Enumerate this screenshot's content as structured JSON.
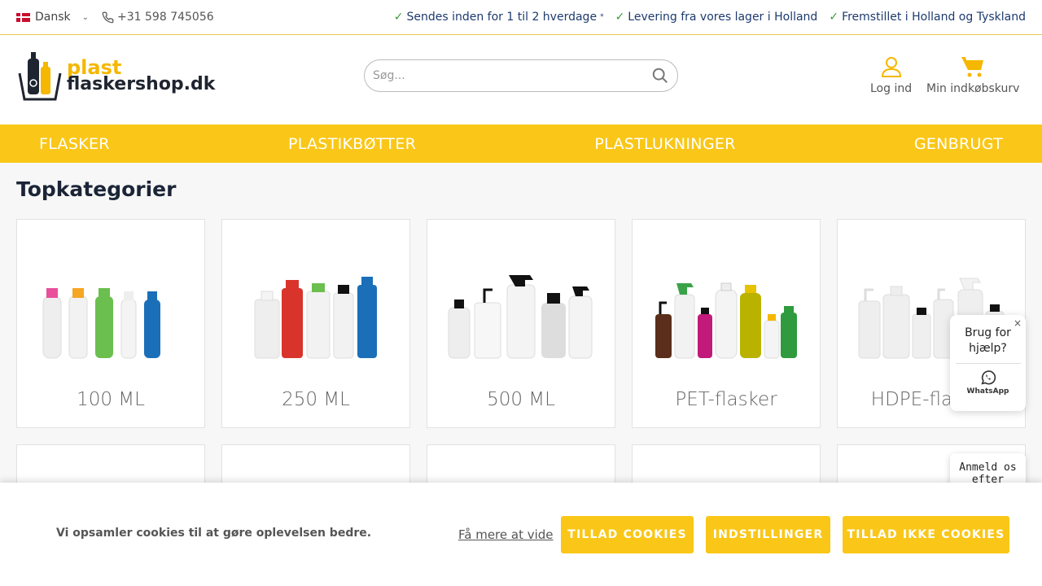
{
  "topbar": {
    "language": "Dansk",
    "phone": "+31 598 745056",
    "usps": [
      {
        "text": "Sendes inden for 1 til 2 hverdage",
        "mark": "*"
      },
      {
        "text": "Levering fra vores lager i Holland",
        "mark": ""
      },
      {
        "text": "Fremstillet i Holland og Tyskland",
        "mark": ""
      }
    ]
  },
  "header": {
    "logo_line1": "plast",
    "logo_line2": "flaskershop.dk",
    "search_placeholder": "Søg...",
    "login_label": "Log ind",
    "cart_label": "Min indkøbskurv"
  },
  "nav": {
    "items": [
      "FLASKER",
      "PLASTIKBØTTER",
      "PLASTLUKNINGER",
      "GENBRUGT"
    ]
  },
  "main": {
    "title": "Topkategorier",
    "categories": [
      {
        "label": "100 ML"
      },
      {
        "label": "250 ML"
      },
      {
        "label": "500 ML"
      },
      {
        "label": "PET-flasker"
      },
      {
        "label": "HDPE-flasker"
      }
    ]
  },
  "help_widget": {
    "text": "Brug for hjælp?",
    "close": "×",
    "whatsapp_label": "WhatsApp"
  },
  "review_widget": {
    "text": "Anmeld os efter"
  },
  "cookie": {
    "message": "Vi opsamler cookies til at gøre oplevelsen bedre.",
    "learn_more": "Få mere at vide",
    "allow": "TILLAD COOKIES",
    "settings": "INDSTILLINGER",
    "deny": "TILLAD IKKE COOKIES"
  },
  "colors": {
    "accent": "#fac718",
    "nav_text": "#ffffff",
    "usp_text": "#1d3a6e"
  }
}
